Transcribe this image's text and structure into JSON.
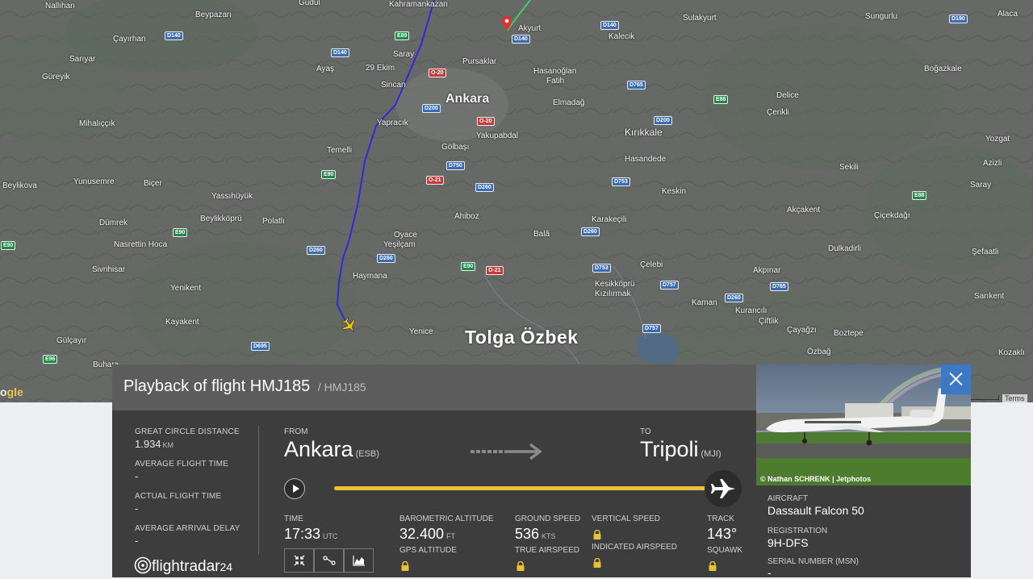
{
  "map": {
    "watermark": "Tolga Özbek",
    "google_logo": "ogle",
    "terms": "Terms",
    "places": [
      {
        "name": "Nallıhan",
        "cls": ""
      },
      {
        "name": "Beypazarı",
        "cls": ""
      },
      {
        "name": "Güdül",
        "cls": ""
      },
      {
        "name": "Kahramankazan",
        "cls": ""
      },
      {
        "name": "Akyurt",
        "cls": ""
      },
      {
        "name": "Sulakyurt",
        "cls": ""
      },
      {
        "name": "Sungurlu",
        "cls": ""
      },
      {
        "name": "Alaca",
        "cls": ""
      },
      {
        "name": "Çayırhan",
        "cls": ""
      },
      {
        "name": "Kalecik",
        "cls": ""
      },
      {
        "name": "Sarıyar",
        "cls": ""
      },
      {
        "name": "Saray",
        "cls": ""
      },
      {
        "name": "Pursaklar",
        "cls": ""
      },
      {
        "name": "Ayaş",
        "cls": ""
      },
      {
        "name": "29 Ekim",
        "cls": ""
      },
      {
        "name": "Güreyik",
        "cls": ""
      },
      {
        "name": "Hasanoğlan",
        "cls": ""
      },
      {
        "name": "Fatih",
        "cls": ""
      },
      {
        "name": "Boğazkale",
        "cls": ""
      },
      {
        "name": "Sincan",
        "cls": ""
      },
      {
        "name": "Ankara",
        "cls": "capital"
      },
      {
        "name": "Elmadağ",
        "cls": ""
      },
      {
        "name": "Delice",
        "cls": ""
      },
      {
        "name": "Mihalıççık",
        "cls": ""
      },
      {
        "name": "Yapracık",
        "cls": ""
      },
      {
        "name": "Kırıkkale",
        "cls": "big"
      },
      {
        "name": "Çerikli",
        "cls": ""
      },
      {
        "name": "Yakupabdal",
        "cls": ""
      },
      {
        "name": "Temelli",
        "cls": ""
      },
      {
        "name": "Gölbaşı",
        "cls": ""
      },
      {
        "name": "Hasandede",
        "cls": ""
      },
      {
        "name": "Yozgat",
        "cls": ""
      },
      {
        "name": "Beylikova",
        "cls": ""
      },
      {
        "name": "Yunusemre",
        "cls": ""
      },
      {
        "name": "Biçer",
        "cls": ""
      },
      {
        "name": "Sekili",
        "cls": ""
      },
      {
        "name": "Azizli",
        "cls": ""
      },
      {
        "name": "Yassıhüyük",
        "cls": ""
      },
      {
        "name": "Keskin",
        "cls": ""
      },
      {
        "name": "Saray",
        "cls": ""
      },
      {
        "name": "Beylikköprü",
        "cls": ""
      },
      {
        "name": "Polatlı",
        "cls": ""
      },
      {
        "name": "Ahiboz",
        "cls": ""
      },
      {
        "name": "Karakeçili",
        "cls": ""
      },
      {
        "name": "Akçakent",
        "cls": ""
      },
      {
        "name": "Çiçekdağı",
        "cls": ""
      },
      {
        "name": "Dümrek",
        "cls": ""
      },
      {
        "name": "Nasrettin Hoca",
        "cls": ""
      },
      {
        "name": "Oyace",
        "cls": ""
      },
      {
        "name": "Yeşilçam",
        "cls": ""
      },
      {
        "name": "Balâ",
        "cls": ""
      },
      {
        "name": "Dulkadirli",
        "cls": ""
      },
      {
        "name": "Şefaatli",
        "cls": ""
      },
      {
        "name": "Sivrihisar",
        "cls": ""
      },
      {
        "name": "Çelebi",
        "cls": ""
      },
      {
        "name": "Akpınar",
        "cls": ""
      },
      {
        "name": "Haymana",
        "cls": ""
      },
      {
        "name": "Kesikköprü",
        "cls": ""
      },
      {
        "name": "Kızılırmak",
        "cls": ""
      },
      {
        "name": "Yenikent",
        "cls": ""
      },
      {
        "name": "Sarıkent",
        "cls": ""
      },
      {
        "name": "Kaman",
        "cls": ""
      },
      {
        "name": "Kurancılı",
        "cls": ""
      },
      {
        "name": "Kayakent",
        "cls": ""
      },
      {
        "name": "Çiftlik",
        "cls": ""
      },
      {
        "name": "Çayağzı",
        "cls": ""
      },
      {
        "name": "Boztepe",
        "cls": ""
      },
      {
        "name": "Yenice",
        "cls": ""
      },
      {
        "name": "Gülçayır",
        "cls": ""
      },
      {
        "name": "Özbağ",
        "cls": ""
      },
      {
        "name": "Kozaklı",
        "cls": ""
      },
      {
        "name": "Buhara",
        "cls": ""
      }
    ],
    "roads": [
      {
        "code": "D140",
        "c": "blue"
      },
      {
        "code": "D140",
        "c": "blue"
      },
      {
        "code": "D140",
        "c": "blue"
      },
      {
        "code": "D140",
        "c": "blue"
      },
      {
        "code": "E89",
        "c": "green"
      },
      {
        "code": "D190",
        "c": "blue"
      },
      {
        "code": "O-20",
        "c": "red"
      },
      {
        "code": "D765",
        "c": "blue"
      },
      {
        "code": "D200",
        "c": "blue"
      },
      {
        "code": "E88",
        "c": "green"
      },
      {
        "code": "O-20",
        "c": "red"
      },
      {
        "code": "D200",
        "c": "blue"
      },
      {
        "code": "D750",
        "c": "blue"
      },
      {
        "code": "O-21",
        "c": "red"
      },
      {
        "code": "D260",
        "c": "blue"
      },
      {
        "code": "D753",
        "c": "blue"
      },
      {
        "code": "E90",
        "c": "green"
      },
      {
        "code": "E88",
        "c": "green"
      },
      {
        "code": "E90",
        "c": "green"
      },
      {
        "code": "D260",
        "c": "blue"
      },
      {
        "code": "D260",
        "c": "blue"
      },
      {
        "code": "E90",
        "c": "green"
      },
      {
        "code": "D260",
        "c": "blue"
      },
      {
        "code": "E90",
        "c": "green"
      },
      {
        "code": "O-21",
        "c": "red"
      },
      {
        "code": "D753",
        "c": "blue"
      },
      {
        "code": "D757",
        "c": "blue"
      },
      {
        "code": "D765",
        "c": "blue"
      },
      {
        "code": "D260",
        "c": "blue"
      },
      {
        "code": "D757",
        "c": "blue"
      },
      {
        "code": "D695",
        "c": "blue"
      },
      {
        "code": "E96",
        "c": "green"
      }
    ]
  },
  "panel": {
    "title": "Playback of flight HMJ185",
    "subtitle": "/ HMJ185",
    "stats": [
      {
        "label": "Great Circle Distance",
        "value": "1.934",
        "unit": "KM"
      },
      {
        "label": "Average Flight Time",
        "value": "-",
        "unit": ""
      },
      {
        "label": "Actual Flight Time",
        "value": "-",
        "unit": ""
      },
      {
        "label": "Average Arrival Delay",
        "value": "-",
        "unit": ""
      }
    ],
    "from": {
      "label": "FROM",
      "city": "Ankara",
      "code": "(ESB)"
    },
    "to": {
      "label": "TO",
      "city": "Tripoli",
      "code": "(MJI)"
    },
    "progress": 0.99,
    "time": {
      "label": "TIME",
      "value": "17:33",
      "unit": "UTC"
    },
    "baro_alt": {
      "label": "BAROMETRIC ALTITUDE",
      "value": "32.400",
      "unit": "FT"
    },
    "gps_alt": {
      "label": "GPS ALTITUDE"
    },
    "ground_speed": {
      "label": "GROUND SPEED",
      "value": "536",
      "unit": "KTS"
    },
    "true_airspeed": {
      "label": "TRUE AIRSPEED"
    },
    "vertical_speed": {
      "label": "VERTICAL SPEED"
    },
    "indicated_airspeed": {
      "label": "INDICATED AIRSPEED"
    },
    "track": {
      "label": "TRACK",
      "value": "143°"
    },
    "squawk": {
      "label": "SQUAWK"
    },
    "logo": {
      "text": "flightradar",
      "num": "24"
    }
  },
  "side": {
    "photo_credit": "© Nathan SCHRENK | Jetphotos",
    "aircraft_label": "AIRCRAFT",
    "aircraft_value": "Dassault Falcon 50",
    "registration_label": "REGISTRATION",
    "registration_value": "9H-DFS",
    "serial_label": "SERIAL NUMBER (MSN)",
    "serial_value": "-"
  },
  "colors": {
    "accent": "#e8c13a",
    "close": "#3c78c4",
    "track_start": "#3ad16d",
    "track_end": "#2b2bd9"
  }
}
